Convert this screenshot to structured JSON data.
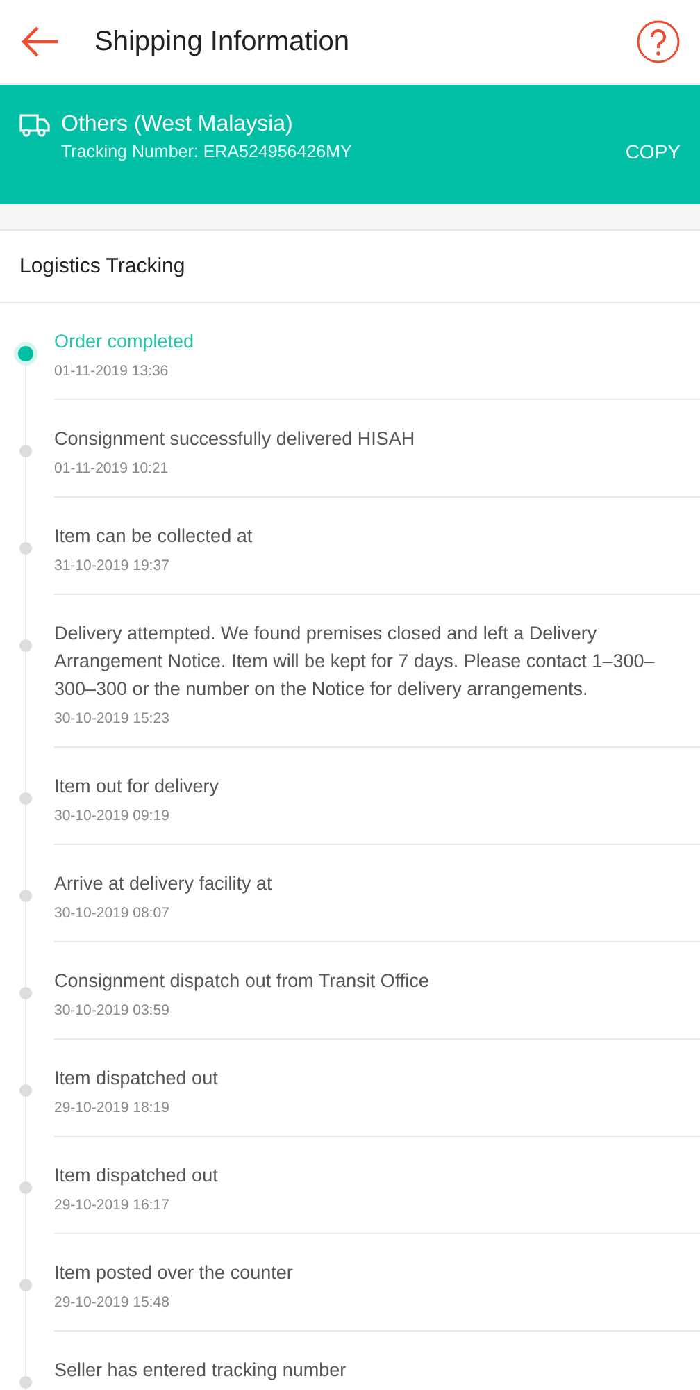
{
  "header": {
    "title": "Shipping Information"
  },
  "shipment": {
    "carrier": "Others (West Malaysia)",
    "tracking": "Tracking Number: ERA524956426MY",
    "copy": "COPY"
  },
  "section_title": "Logistics Tracking",
  "events": [
    {
      "title": "Order completed",
      "time": "01-11-2019 13:36",
      "current": true
    },
    {
      "title": "Consignment successfully delivered HISAH",
      "time": "01-11-2019 10:21",
      "current": false
    },
    {
      "title": "Item can be collected at",
      "time": "31-10-2019 19:37",
      "current": false
    },
    {
      "title": "Delivery attempted. We found premises closed and left a Delivery Arrangement Notice. Item will be kept for 7 days. Please contact 1–300–300–300 or the number on the Notice for delivery arrangements.",
      "time": "30-10-2019 15:23",
      "current": false
    },
    {
      "title": "Item out for delivery",
      "time": "30-10-2019 09:19",
      "current": false
    },
    {
      "title": "Arrive at delivery facility at",
      "time": "30-10-2019 08:07",
      "current": false
    },
    {
      "title": "Consignment dispatch out from Transit Office",
      "time": "30-10-2019 03:59",
      "current": false
    },
    {
      "title": "Item dispatched out",
      "time": "29-10-2019 18:19",
      "current": false
    },
    {
      "title": "Item dispatched out",
      "time": "29-10-2019 16:17",
      "current": false
    },
    {
      "title": "Item posted over the counter",
      "time": "29-10-2019 15:48",
      "current": false
    },
    {
      "title": "Seller has entered tracking number",
      "current": false
    }
  ]
}
